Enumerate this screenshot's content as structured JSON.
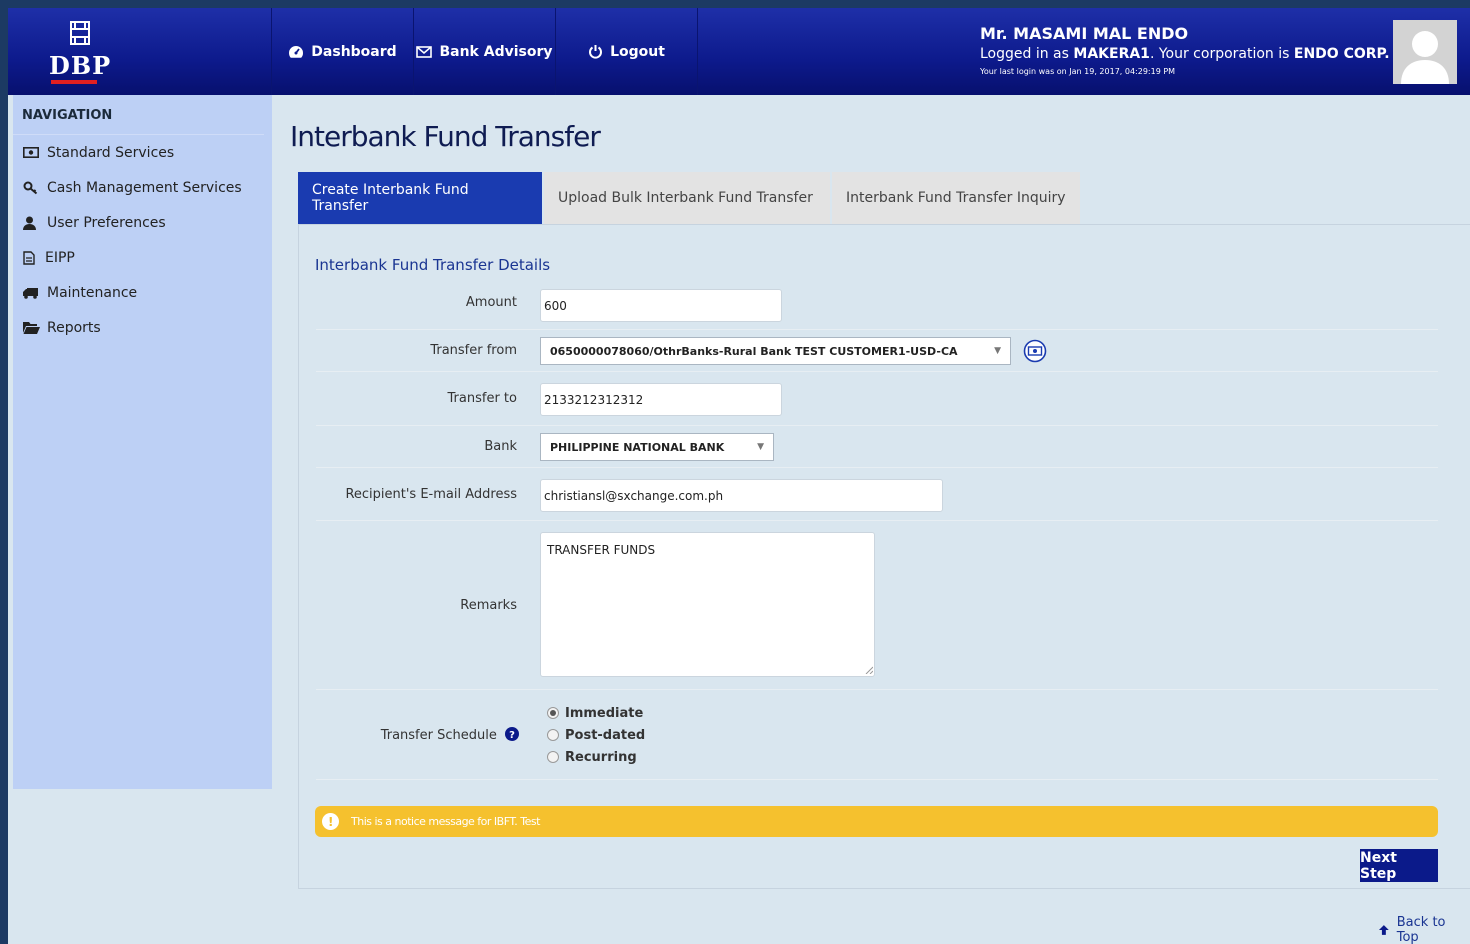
{
  "brand": {
    "logo_text": "DBP"
  },
  "top_nav": {
    "dashboard": "Dashboard",
    "bank_advisory": "Bank Advisory",
    "logout": "Logout"
  },
  "user": {
    "name": "Mr. MASAMI MAL ENDO",
    "login_prefix": "Logged in as ",
    "username": "MAKERA1",
    "corp_prefix": ". Your corporation is ",
    "corporation": "ENDO CORP.",
    "last_login": "Your last login was on Jan 19, 2017, 04:29:19 PM"
  },
  "sidebar": {
    "title": "NAVIGATION",
    "items": [
      {
        "label": "Standard Services",
        "icon": "money-icon"
      },
      {
        "label": "Cash Management Services",
        "icon": "key-icon"
      },
      {
        "label": "User Preferences",
        "icon": "user-icon"
      },
      {
        "label": "EIPP",
        "icon": "document-icon"
      },
      {
        "label": "Maintenance",
        "icon": "truck-icon"
      },
      {
        "label": "Reports",
        "icon": "folder-icon"
      }
    ]
  },
  "page": {
    "title": "Interbank Fund Transfer",
    "tabs": [
      {
        "label": "Create Interbank Fund Transfer",
        "active": true
      },
      {
        "label": "Upload Bulk Interbank Fund Transfer",
        "active": false
      },
      {
        "label": "Interbank Fund Transfer Inquiry",
        "active": false
      }
    ],
    "section_title": "Interbank Fund Transfer Details"
  },
  "form": {
    "amount": {
      "label": "Amount",
      "value": "600"
    },
    "transfer_from": {
      "label": "Transfer from",
      "value": "0650000078060/OthrBanks-Rural Bank TEST CUSTOMER1-USD-CA"
    },
    "transfer_to": {
      "label": "Transfer to",
      "value": "2133212312312"
    },
    "bank": {
      "label": "Bank",
      "value": "PHILIPPINE NATIONAL BANK"
    },
    "email": {
      "label": "Recipient's E-mail Address",
      "value": "christiansl@sxchange.com.ph"
    },
    "remarks": {
      "label": "Remarks",
      "value": "TRANSFER FUNDS"
    },
    "schedule": {
      "label": "Transfer Schedule",
      "options": [
        {
          "label": "Immediate",
          "checked": true
        },
        {
          "label": "Post-dated",
          "checked": false
        },
        {
          "label": "Recurring",
          "checked": false
        }
      ]
    }
  },
  "notice": "This is a notice message for IBFT. Test",
  "actions": {
    "next_step": "Next Step",
    "back_to_top": "Back to Top"
  },
  "colors": {
    "header": "#0d1a8c",
    "sidebar": "#bdd0f5",
    "active_tab": "#1a3bb0",
    "notice": "#f5c12e",
    "button": "#0b1a8a"
  }
}
